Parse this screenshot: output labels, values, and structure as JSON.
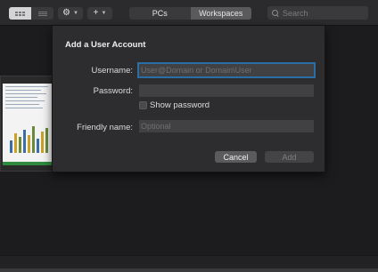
{
  "toolbar": {
    "view_toggle": {
      "grid_icon": "grid-view-icon",
      "list_icon": "list-view-icon"
    },
    "gear": {
      "icon": "gear-icon",
      "chevron": "chevron-down-icon"
    },
    "add": {
      "icon": "plus-icon",
      "chevron": "chevron-down-icon"
    },
    "tabs": [
      {
        "label": "PCs",
        "selected": false
      },
      {
        "label": "Workspaces",
        "selected": true
      }
    ],
    "search": {
      "placeholder": "Search",
      "icon": "search-icon"
    }
  },
  "dialog": {
    "title": "Add a User Account",
    "username": {
      "label": "Username:",
      "placeholder": "User@Domain or Domain\\User",
      "value": ""
    },
    "password": {
      "label": "Password:",
      "value": ""
    },
    "show_password": {
      "label": "Show password",
      "checked": false
    },
    "friendly_name": {
      "label": "Friendly name:",
      "placeholder": "Optional",
      "value": ""
    },
    "cancel_label": "Cancel",
    "add_label": "Add"
  },
  "colors": {
    "background": "#1c1c1e",
    "toolbar": "#2b2b2d",
    "dialog": "#2d2d2f",
    "focus_ring": "#2b6ea3"
  }
}
